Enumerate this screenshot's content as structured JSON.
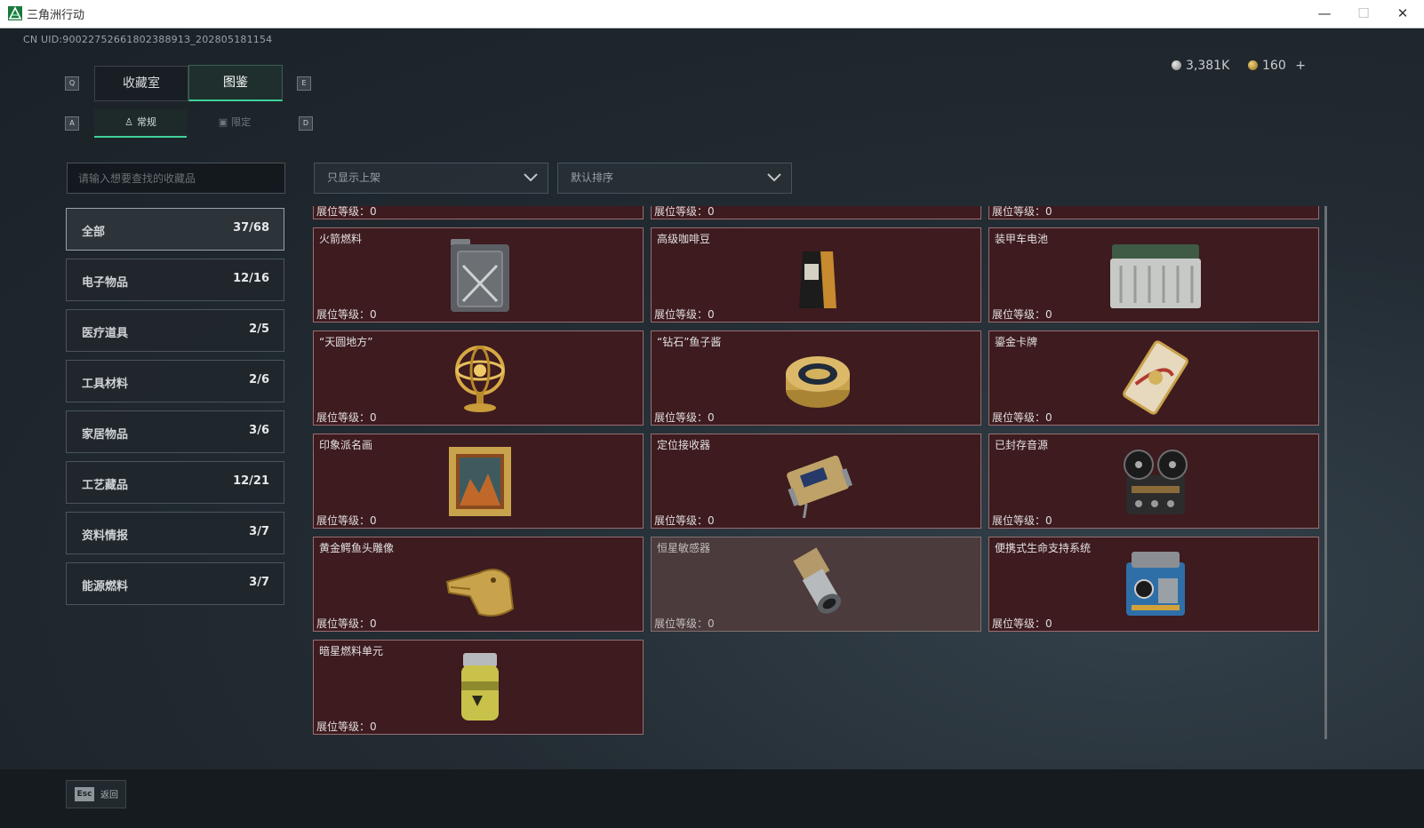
{
  "window": {
    "title": "三角洲行动"
  },
  "header": {
    "uid": "CN UID:9002275266180238891З_202805181154",
    "currency1": "3,381K",
    "currency2": "160",
    "add": "+"
  },
  "tabs": {
    "key_left": "Q",
    "key_right": "E",
    "items": [
      {
        "label": "收藏室"
      },
      {
        "label": "图鉴"
      }
    ]
  },
  "subtabs": {
    "key_left": "A",
    "key_right": "D",
    "items": [
      {
        "label": "常规"
      },
      {
        "label": "限定"
      }
    ]
  },
  "search": {
    "placeholder": "请输入想要查找的收藏品"
  },
  "filters": {
    "filter_label": "只显示上架",
    "sort_label": "默认排序"
  },
  "categories": [
    {
      "label": "全部",
      "count": "37/68"
    },
    {
      "label": "电子物品",
      "count": "12/16"
    },
    {
      "label": "医疗道具",
      "count": "2/5"
    },
    {
      "label": "工具材料",
      "count": "2/6"
    },
    {
      "label": "家居物品",
      "count": "3/6"
    },
    {
      "label": "工艺藏品",
      "count": "12/21"
    },
    {
      "label": "资料情报",
      "count": "3/7"
    },
    {
      "label": "能源燃料",
      "count": "3/7"
    }
  ],
  "level_label": "展位等级：0",
  "items": [
    {
      "name": "",
      "icon": "cut-off-item"
    },
    {
      "name": "",
      "icon": "cut-off-item"
    },
    {
      "name": "",
      "icon": "cut-off-item"
    },
    {
      "name": "火箭燃料",
      "icon": "fuel-canister-icon"
    },
    {
      "name": "高级咖啡豆",
      "icon": "coffee-bag-icon"
    },
    {
      "name": "装甲车电池",
      "icon": "battery-icon"
    },
    {
      "name": "“天圆地方”",
      "icon": "armillary-sphere-icon"
    },
    {
      "name": "“钻石”鱼子酱",
      "icon": "caviar-tin-icon"
    },
    {
      "name": "鎏金卡牌",
      "icon": "gold-card-icon"
    },
    {
      "name": "印象派名画",
      "icon": "framed-painting-icon"
    },
    {
      "name": "定位接收器",
      "icon": "receiver-device-icon"
    },
    {
      "name": "已封存音源",
      "icon": "tape-recorder-icon"
    },
    {
      "name": "黄金鳄鱼头雕像",
      "icon": "gold-crocodile-icon"
    },
    {
      "name": "恒星敏感器",
      "icon": "star-sensor-icon"
    },
    {
      "name": "便携式生命支持系统",
      "icon": "life-support-icon"
    },
    {
      "name": "暗星燃料单元",
      "icon": "fuel-cell-icon"
    }
  ],
  "footer": {
    "esc_key": "Esc",
    "back_label": "返回"
  },
  "colors": {
    "accent": "#3fd19a",
    "card": "#3d1b1f",
    "card_border": "#9a6e72",
    "card_unowned": "#4b3b3c"
  }
}
